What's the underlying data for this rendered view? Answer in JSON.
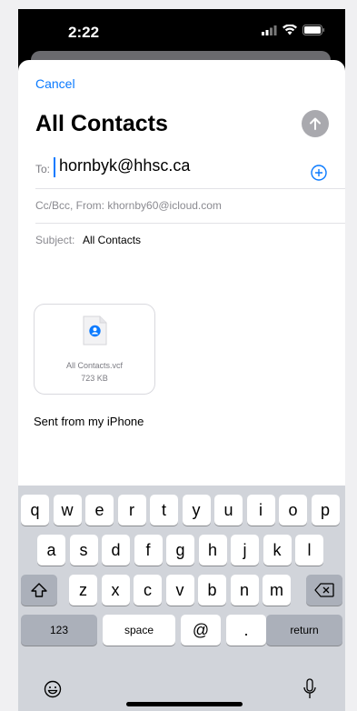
{
  "status": {
    "time": "2:22",
    "signal_icon": "cellular-signal-icon",
    "wifi_icon": "wifi-icon",
    "battery_icon": "battery-icon"
  },
  "compose": {
    "cancel": "Cancel",
    "title": "All Contacts",
    "to_label": "To:",
    "to_value": "hornbyk@hhsc.ca",
    "cc_from": "Cc/Bcc, From:  khornby60@icloud.com",
    "subject_label": "Subject:",
    "subject_value": "All Contacts",
    "attachment": {
      "filename": "All Contacts.vcf",
      "size": "723 KB"
    },
    "signature": "Sent from my iPhone"
  },
  "keyboard": {
    "row1": [
      "q",
      "w",
      "e",
      "r",
      "t",
      "y",
      "u",
      "i",
      "o",
      "p"
    ],
    "row2": [
      "a",
      "s",
      "d",
      "f",
      "g",
      "h",
      "j",
      "k",
      "l"
    ],
    "row3": [
      "z",
      "x",
      "c",
      "v",
      "b",
      "n",
      "m"
    ],
    "numbers": "123",
    "space": "space",
    "at": "@",
    "dot": ".",
    "return": "return"
  },
  "colors": {
    "accent": "#0a7aff",
    "keyboard_bg": "#d1d4da",
    "key_dark": "#abb0ba"
  }
}
